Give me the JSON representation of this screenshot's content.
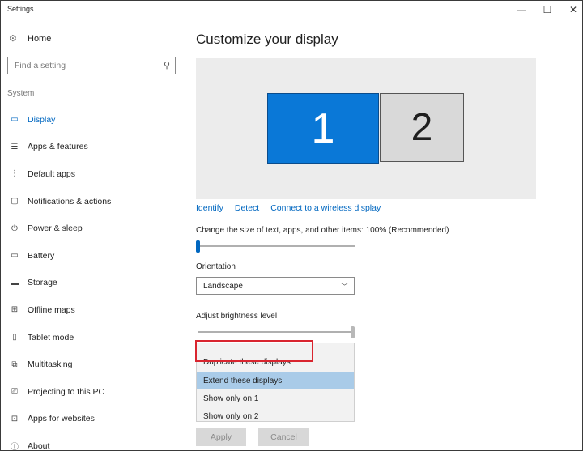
{
  "window": {
    "title": "Settings",
    "minimize_glyph": "—",
    "maximize_glyph": "☐",
    "close_glyph": "✕"
  },
  "sidebar": {
    "home_label": "Home",
    "home_icon": "gear-icon",
    "search_placeholder": "Find a setting",
    "section_label": "System",
    "items": [
      {
        "label": "Display",
        "icon": "monitor-icon",
        "active": true
      },
      {
        "label": "Apps & features",
        "icon": "apps-list-icon"
      },
      {
        "label": "Default apps",
        "icon": "default-apps-icon"
      },
      {
        "label": "Notifications & actions",
        "icon": "notification-icon"
      },
      {
        "label": "Power & sleep",
        "icon": "power-icon"
      },
      {
        "label": "Battery",
        "icon": "battery-icon"
      },
      {
        "label": "Storage",
        "icon": "storage-icon"
      },
      {
        "label": "Offline maps",
        "icon": "map-icon"
      },
      {
        "label": "Tablet mode",
        "icon": "tablet-icon"
      },
      {
        "label": "Multitasking",
        "icon": "multitasking-icon"
      },
      {
        "label": "Projecting to this PC",
        "icon": "projecting-icon"
      },
      {
        "label": "Apps for websites",
        "icon": "apps-websites-icon"
      },
      {
        "label": "About",
        "icon": "info-icon"
      }
    ]
  },
  "main": {
    "title": "Customize your display",
    "monitors": [
      "1",
      "2"
    ],
    "links": [
      "Identify",
      "Detect",
      "Connect to a wireless display"
    ],
    "scale_label": "Change the size of text, apps, and other items: 100% (Recommended)",
    "scale_value_fraction": 0.0,
    "orientation_label": "Orientation",
    "orientation_value": "Landscape",
    "brightness_label": "Adjust brightness level",
    "brightness_value_fraction": 1.0,
    "dropdown_options": [
      "Duplicate these displays",
      "Extend these displays",
      "Show only on 1",
      "Show only on 2"
    ],
    "highlighted_option": "Extend these displays",
    "apply_label": "Apply",
    "cancel_label": "Cancel"
  },
  "colors": {
    "accent": "#0067c0",
    "monitor_selected": "#0a78d7",
    "highlight_box": "#d9252f"
  }
}
